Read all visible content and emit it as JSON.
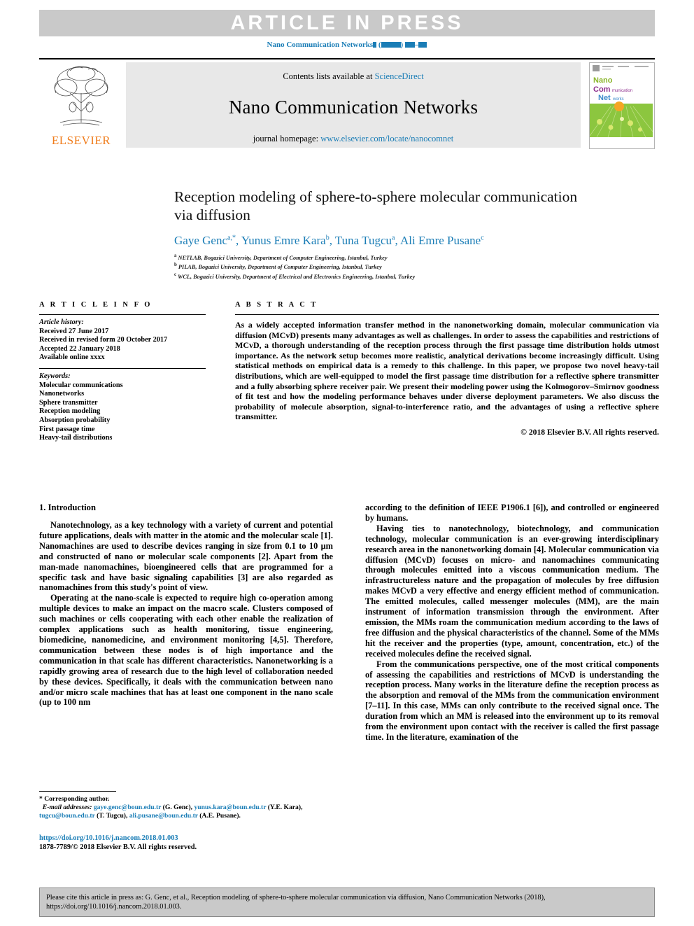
{
  "banner": {
    "text": "ARTICLE IN PRESS",
    "journal_ref_prefix": "Nano Communication Networks",
    "journal_ref_suffix": "( ) –"
  },
  "masthead": {
    "contents_prefix": "Contents lists available at ",
    "sciencedirect": "ScienceDirect",
    "journal_title": "Nano Communication Networks",
    "homepage_prefix": "journal homepage: ",
    "homepage_url": "www.elsevier.com/locate/nanocomnet",
    "publisher": "ELSEVIER",
    "cover": {
      "line_nano": "Nano",
      "line_com": "Com",
      "line_com_small": "munication",
      "line_net": "Net",
      "line_net_small": "works"
    }
  },
  "article": {
    "title_line1": "Reception modeling of sphere-to-sphere molecular communication",
    "title_line2": "via diffusion",
    "authors": [
      {
        "name": "Gaye Genc",
        "sup": "a,*"
      },
      {
        "name": "Yunus Emre Kara",
        "sup": "b"
      },
      {
        "name": "Tuna Tugcu",
        "sup": "a"
      },
      {
        "name": "Ali Emre Pusane",
        "sup": "c"
      }
    ],
    "affiliations": [
      {
        "sup": "a",
        "text": "NETLAB, Bogazici University, Department of Computer Engineering, Istanbul, Turkey"
      },
      {
        "sup": "b",
        "text": "PILAB, Bogazici University, Department of Computer Engineering, Istanbul, Turkey"
      },
      {
        "sup": "c",
        "text": "WCL, Bogazici University, Department of Electrical and Electronics Engineering, Istanbul, Turkey"
      }
    ]
  },
  "info": {
    "heading": "A R T I C L E   I N F O",
    "history_label": "Article history:",
    "history": [
      "Received 27 June 2017",
      "Received in revised form 20 October 2017",
      "Accepted 22 January 2018",
      "Available online xxxx"
    ],
    "keywords_label": "Keywords:",
    "keywords": [
      "Molecular communications",
      "Nanonetworks",
      "Sphere transmitter",
      "Reception modeling",
      "Absorption probability",
      "First passage time",
      "Heavy-tail distributions"
    ]
  },
  "abstract": {
    "heading": "A B S T R A C T",
    "text": "As a widely accepted information transfer method in the nanonetworking domain, molecular communication via diffusion (MCvD) presents many advantages as well as challenges. In order to assess the capabilities and restrictions of MCvD, a thorough understanding of the reception process through the first passage time distribution holds utmost importance. As the network setup becomes more realistic, analytical derivations become increasingly difficult. Using statistical methods on empirical data is a remedy to this challenge. In this paper, we propose two novel heavy-tail distributions, which are well-equipped to model the first passage time distribution for a reflective sphere transmitter and a fully absorbing sphere receiver pair. We present their modeling power using the Kolmogorov–Smirnov goodness of fit test and how the modeling performance behaves under diverse deployment parameters. We also discuss the probability of molecule absorption, signal-to-interference ratio, and the advantages of using a reflective sphere transmitter.",
    "copyright": "© 2018 Elsevier B.V. All rights reserved."
  },
  "body": {
    "section_heading": "1. Introduction",
    "left_paragraphs": [
      "Nanotechnology, as a key technology with a variety of current and potential future applications, deals with matter in the atomic and the molecular scale [1]. Nanomachines are used to describe devices ranging in size from 0.1 to 10 μm and constructed of nano or molecular scale components [2]. Apart from the man-made nanomachines, bioengineered cells that are programmed for a specific task and have basic signaling capabilities [3] are also regarded as nanomachines from this study's point of view.",
      "Operating at the nano-scale is expected to require high co-operation among multiple devices to make an impact on the macro scale. Clusters composed of such machines or cells cooperating with each other enable the realization of complex applications such as health monitoring, tissue engineering, biomedicine, nanomedicine, and environment monitoring [4,5]. Therefore, communication between these nodes is of high importance and the communication in that scale has different characteristics. Nanonetworking is a rapidly growing area of research due to the high level of collaboration needed by these devices. Specifically, it deals with the communication between nano and/or micro scale machines that has at least one component in the nano scale (up to 100 nm"
    ],
    "right_paragraphs": [
      "according to the definition of IEEE P1906.1 [6]), and controlled or engineered by humans.",
      "Having ties to nanotechnology, biotechnology, and communication technology, molecular communication is an ever-growing interdisciplinary research area in the nanonetworking domain [4]. Molecular communication via diffusion (MCvD) focuses on micro- and nanomachines communicating through molecules emitted into a viscous communication medium. The infrastructureless nature and the propagation of molecules by free diffusion makes MCvD a very effective and energy efficient method of communication. The emitted molecules, called messenger molecules (MM), are the main instrument of information transmission through the environment. After emission, the MMs roam the communication medium according to the laws of free diffusion and the physical characteristics of the channel. Some of the MMs hit the receiver and the properties (type, amount, concentration, etc.) of the received molecules define the received signal.",
      "From the communications perspective, one of the most critical components of assessing the capabilities and restrictions of MCvD is understanding the reception process. Many works in the literature define the reception process as the absorption and removal of the MMs from the communication environment [7–11]. In this case, MMs can only contribute to the received signal once. The duration from which an MM is released into the environment up to its removal from the environment upon contact with the receiver is called the first passage time. In the literature, examination of the"
    ]
  },
  "footnote": {
    "corresponding": "* Corresponding author.",
    "email_label": "E-mail addresses:",
    "emails": [
      {
        "address": "gaye.genc@boun.edu.tr",
        "owner": "(G. Genc)"
      },
      {
        "address": "yunus.kara@boun.edu.tr",
        "owner": "(Y.E. Kara)"
      },
      {
        "address": "tugcu@boun.edu.tr",
        "owner": "(T. Tugcu)"
      },
      {
        "address": "ali.pusane@boun.edu.tr",
        "owner": "(A.E. Pusane)."
      }
    ],
    "doi": "https://doi.org/10.1016/j.nancom.2018.01.003",
    "issn_line": "1878-7789/© 2018 Elsevier B.V. All rights reserved."
  },
  "citation_box": {
    "line1": "Please cite this article in press as: G. Genc, et al., Reception modeling of sphere-to-sphere molecular communication via diffusion, Nano Communication Networks (2018),",
    "line2": "https://doi.org/10.1016/j.nancom.2018.01.003."
  },
  "colors": {
    "link": "#1a7db6",
    "banner_bg": "#c9c9c9",
    "elsevier_orange": "#f07c1b"
  }
}
